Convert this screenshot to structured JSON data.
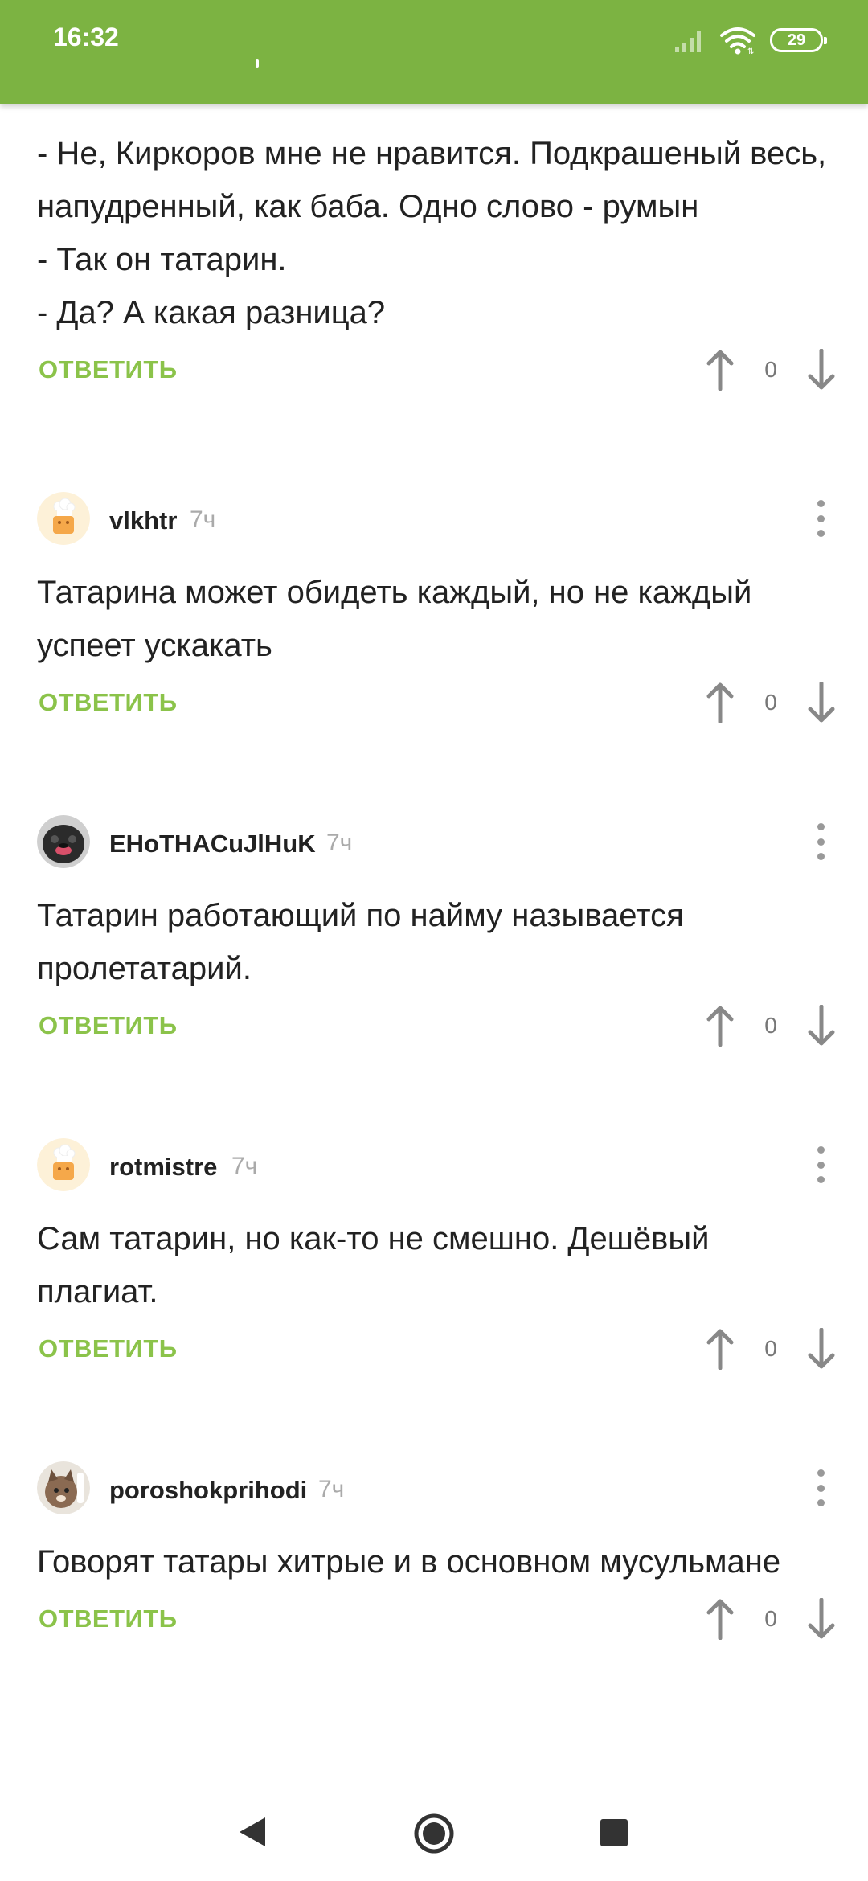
{
  "status_bar": {
    "time": "16:32",
    "battery": "29",
    "icons": [
      "signal-icon",
      "wifi-icon",
      "battery-icon"
    ],
    "color": "#7cb342"
  },
  "accent_color": "#8bc34a",
  "first_comment": {
    "lines": [
      "- Не, Киркоров мне не нравится. Подкрашеный весь, напудренный, как баба. Одно слово - румын",
      "- Так он татарин.",
      "- Да? А какая разница?"
    ],
    "reply_label": "ОТВЕТИТЬ",
    "votes": "0"
  },
  "comments": [
    {
      "username": "vlkhtr",
      "time": "7ч",
      "avatar": "default-avatar-icon",
      "text": "Татарина может обидеть каждый, но не каждый успеет ускакать",
      "reply_label": "ОТВЕТИТЬ",
      "votes": "0"
    },
    {
      "username": "EHoTHACuJlHuK",
      "time": "7ч",
      "avatar": "dog-avatar-icon",
      "text": "Татарин работающий по найму называется пролетатарий.",
      "reply_label": "ОТВЕТИТЬ",
      "votes": "0"
    },
    {
      "username": "rotmistre",
      "time": "7ч",
      "avatar": "default-avatar-icon",
      "text": "Сам татарин, но как-то не смешно. Дешёвый плагиат.",
      "reply_label": "ОТВЕТИТЬ",
      "votes": "0"
    },
    {
      "username": "poroshokprihodi",
      "time": "7ч",
      "avatar": "cat-avatar-icon",
      "text": "Говорят татары хитрые и в основном мусульмане",
      "reply_label": "ОТВЕТИТЬ",
      "votes": "0"
    }
  ],
  "nav": {
    "icons": [
      "back-icon",
      "home-icon",
      "recent-apps-icon"
    ]
  }
}
